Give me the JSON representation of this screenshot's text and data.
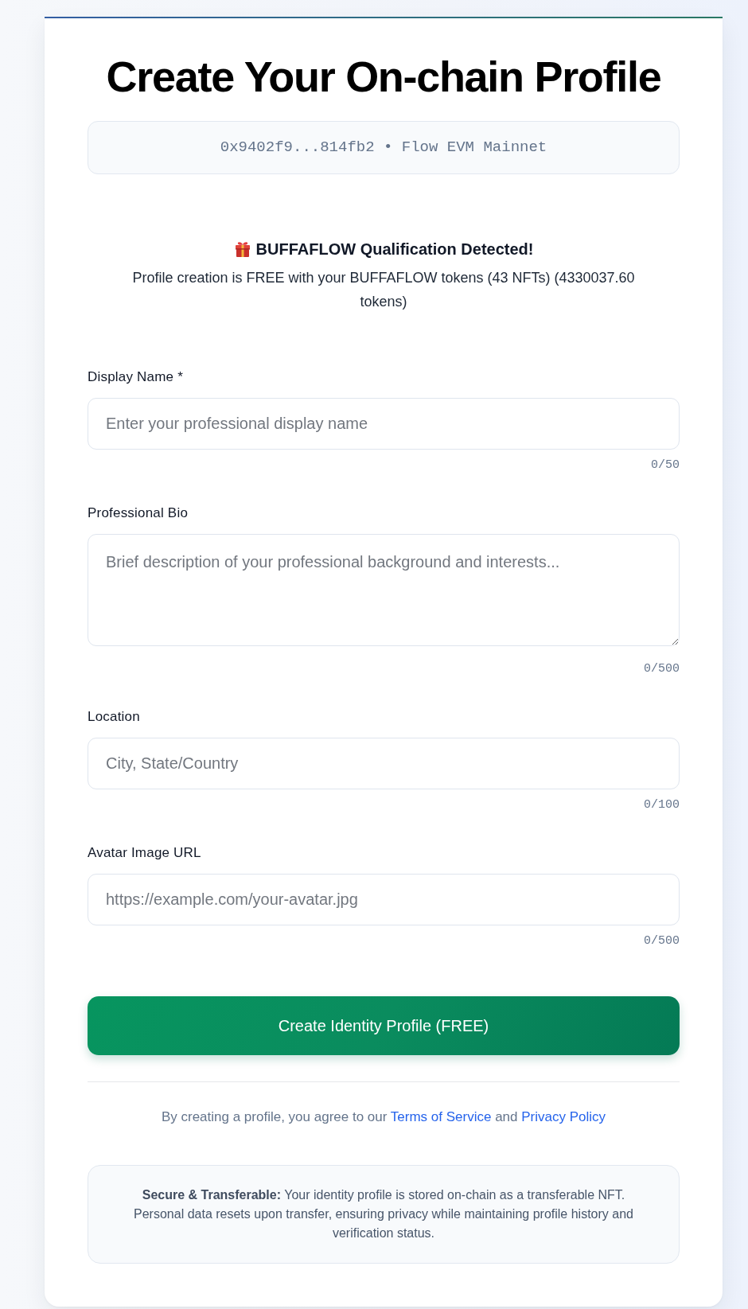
{
  "title": "Create Your On-chain Profile",
  "wallet_info": "0x9402f9...814fb2 • Flow EVM Mainnet",
  "qualification": {
    "title": "BUFFAFLOW Qualification Detected!",
    "message": "Profile creation is FREE with your BUFFAFLOW tokens (43 NFTs) (4330037.60 tokens)"
  },
  "fields": [
    {
      "kind": "text",
      "label": "Display Name *",
      "placeholder": "Enter your professional display name",
      "counter": "0/50"
    },
    {
      "kind": "textarea",
      "label": "Professional Bio",
      "placeholder": "Brief description of your professional background and interests...",
      "counter": "0/500"
    },
    {
      "kind": "text",
      "label": "Location",
      "placeholder": "City, State/Country",
      "counter": "0/100"
    },
    {
      "kind": "text",
      "label": "Avatar Image URL",
      "placeholder": "https://example.com/your-avatar.jpg",
      "counter": "0/500"
    }
  ],
  "submit_button": "Create Identity Profile (FREE)",
  "terms": [
    {
      "kind": "text",
      "text": "By creating a profile, you agree to our"
    },
    {
      "kind": "link",
      "text": "Terms of Service"
    },
    {
      "kind": "text",
      "text": "and"
    },
    {
      "kind": "link",
      "text": "Privacy Policy"
    }
  ],
  "security_note": "**Secure & Transferable:** Your identity profile is stored on-chain as a transferable NFT. Personal data resets upon transfer, ensuring privacy while maintaining profile history and verification status."
}
